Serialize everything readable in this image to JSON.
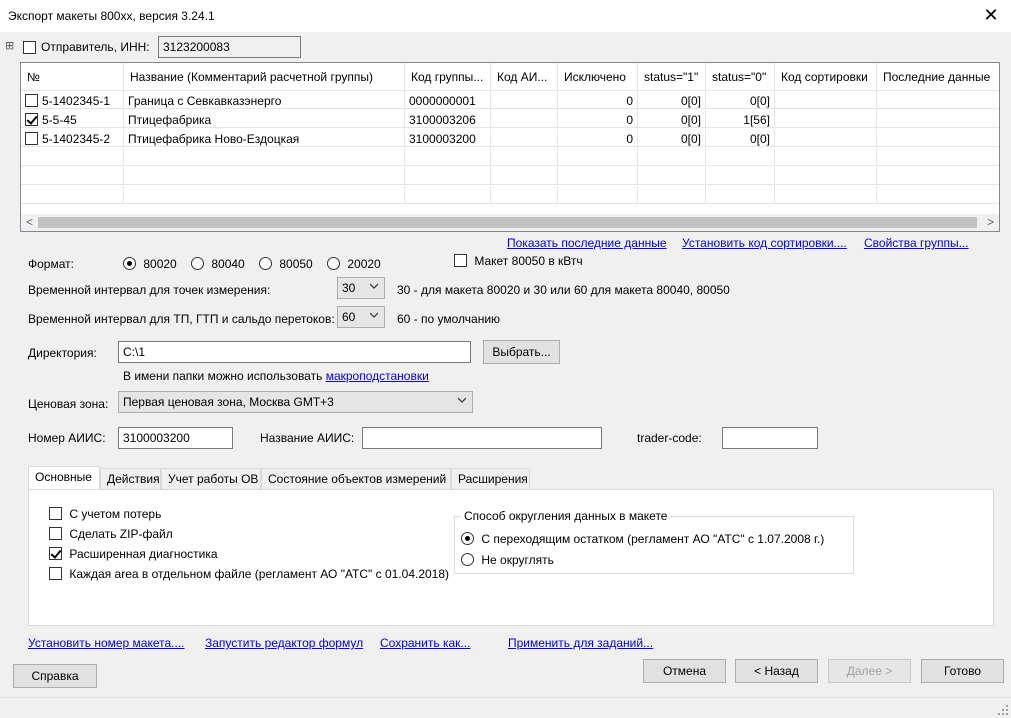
{
  "window": {
    "title": "Экспорт макеты 800xx, версия 3.24.1",
    "close_glyph": "✕"
  },
  "sender": {
    "label": "Отправитель, ИНН:",
    "inn": "3123200083",
    "expand_glyph": "⊞"
  },
  "grid": {
    "columns": [
      "№",
      "Название (Комментарий расчетной группы)",
      "Код группы...",
      "Код АИ...",
      "Исключено",
      "status=\"1\"",
      "status=\"0\"",
      "Код сортировки",
      "Последние данные"
    ],
    "rows": [
      {
        "checked": false,
        "num": "5-1402345-1",
        "name": "Граница с Севкавказэнерго",
        "code": "0000000001",
        "aiis": "",
        "excluded": "0",
        "s1": "0[0]",
        "s0": "0[0]",
        "sort": "",
        "last": ""
      },
      {
        "checked": true,
        "num": "5-5-45",
        "name": "Птицефабрика",
        "code": "3100003206",
        "aiis": "",
        "excluded": "0",
        "s1": "0[0]",
        "s0": "1[56]",
        "sort": "",
        "last": ""
      },
      {
        "checked": false,
        "num": "5-1402345-2",
        "name": "Птицефабрика Ново-Ездоцкая",
        "code": "3100003200",
        "aiis": "",
        "excluded": "0",
        "s1": "0[0]",
        "s0": "0[0]",
        "sort": "",
        "last": ""
      }
    ],
    "scroll_left": "<",
    "scroll_right": ">"
  },
  "links_top": {
    "show_last": "Показать последние данные",
    "set_sort": "Установить код сортировки....",
    "group_props": "Свойства группы..."
  },
  "format": {
    "label": "Формат:",
    "options": [
      "80020",
      "80040",
      "80050",
      "20020"
    ],
    "selected": "80020",
    "kwh_label": "Макет 80050 в кВтч"
  },
  "interval_points": {
    "label": "Временной интервал для точек измерения:",
    "value": "30",
    "hint": "30 - для макета 80020 и 30 или 60 для макета 80040, 80050"
  },
  "interval_tp": {
    "label": "Временной интервал для ТП, ГТП и сальдо перетоков:",
    "value": "60",
    "hint": "60 - по умолчанию"
  },
  "directory": {
    "label": "Директория:",
    "value": "C:\\1",
    "browse": "Выбрать...",
    "hint_prefix": "В имени папки можно использовать",
    "hint_link": "макроподстановки"
  },
  "price_zone": {
    "label": "Ценовая зона:",
    "value": "Первая ценовая зона, Москва GMT+3"
  },
  "aiis": {
    "number_label": "Номер АИИС:",
    "number_value": "3100003200",
    "name_label": "Название АИИС:",
    "name_value": "",
    "trader_label": "trader-code:",
    "trader_value": ""
  },
  "tabs": [
    {
      "label": "Основные",
      "active": true
    },
    {
      "label": "Действия",
      "active": false
    },
    {
      "label": "Учет работы ОВ",
      "active": false
    },
    {
      "label": "Состояние объектов измерений",
      "active": false
    },
    {
      "label": "Расширения",
      "active": false
    }
  ],
  "main_tab": {
    "options": [
      {
        "label": "С учетом потерь",
        "checked": false
      },
      {
        "label": "Сделать ZIP-файл",
        "checked": false
      },
      {
        "label": "Расширенная диагностика",
        "checked": true
      },
      {
        "label": "Каждая area в отдельном файле (регламент АО \"АТС\" с 01.04.2018)",
        "checked": false
      }
    ],
    "rounding": {
      "title": "Способ округления данных в макете",
      "options": [
        {
          "label": "С переходящим остатком (регламент АО \"АТС\" с 1.07.2008 г.)",
          "checked": true
        },
        {
          "label": "Не округлять",
          "checked": false
        }
      ]
    }
  },
  "links_bottom": {
    "set_number": "Установить номер макета....",
    "formula_editor": "Запустить редактор формул",
    "save_as": "Сохранить как...",
    "apply_tasks": "Применить для заданий..."
  },
  "buttons": {
    "help": "Справка",
    "cancel": "Отмена",
    "back": "< Назад",
    "next": "Далее >",
    "done": "Готово"
  }
}
